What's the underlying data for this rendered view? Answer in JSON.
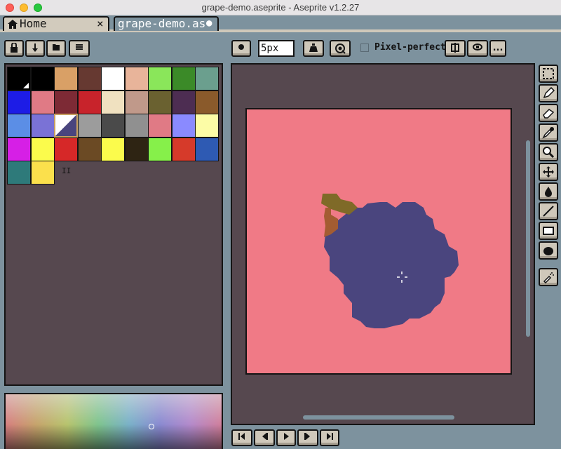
{
  "window": {
    "title": "grape-demo.aseprite - Aseprite v1.2.27"
  },
  "tabs": [
    {
      "label": "Home",
      "close_symbol": "×"
    },
    {
      "label": "grape-demo.as",
      "modified_symbol": "●"
    }
  ],
  "toolbar": {
    "brush_size_value": "5px",
    "pixel_perfect_label": "Pixel-perfect",
    "pixel_perfect_checked": false,
    "more_label": "..."
  },
  "palette": {
    "colors": [
      "#000000",
      "#000000",
      "#d9a066",
      "#663931",
      "#ffffff",
      "#e8b49a",
      "#8ae65a",
      "#3b8a28",
      "#6b9f8e",
      "#1d1ce6",
      "#e07a85",
      "#7d2a35",
      "#c8232b",
      "#f0e1c0",
      "#c0998a",
      "#6a6130",
      "#4d2d52",
      "#8a5a2b",
      "#5b8ee6",
      "#7a72d6",
      "#4a457e",
      "#9c9c9c",
      "#4a4a4a",
      "#909090",
      "#e07a85",
      "#8a8aff",
      "#fcfca6",
      "#d61fe6",
      "#fbfb4c",
      "#d62828",
      "#6b4a24",
      "#fbfb4c",
      "#2e2413",
      "#86f04a",
      "#d63a2a",
      "#2e5ab3",
      "#2e7a7a",
      "#fbe04c"
    ],
    "selected_index": 20,
    "drag_handle": "II"
  },
  "colors": {
    "background": "#7d929e",
    "panel_bg": "#56484f",
    "canvas_bg": "#f07a86",
    "grape": "#4a457e",
    "stem": "#a35c32",
    "leaf": "#7f6a28"
  },
  "timeline": {
    "buttons": [
      "first-frame",
      "prev-frame",
      "play",
      "next-frame",
      "last-frame"
    ]
  },
  "tools": [
    "marquee",
    "pencil",
    "eraser",
    "eyedropper",
    "zoom",
    "move",
    "paint-bucket",
    "line",
    "rectangle",
    "ellipse",
    "spray"
  ]
}
